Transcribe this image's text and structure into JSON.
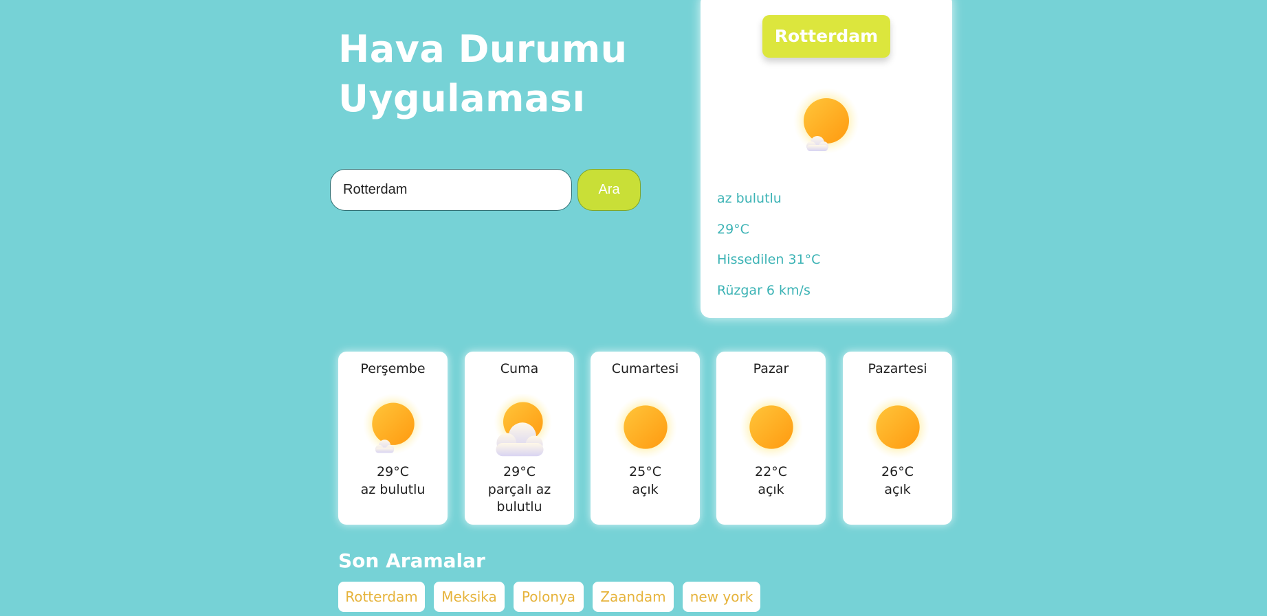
{
  "header": {
    "title_line1": "Hava Durumu",
    "title_line2": "Uygulaması"
  },
  "search": {
    "value": "Rotterdam",
    "button_label": "Ara"
  },
  "current": {
    "city": "Rotterdam",
    "icon": "sun-with-small-cloud-icon",
    "description": "az bulutlu",
    "temperature": "29°C",
    "feels_like": "Hissedilen 31°C",
    "wind": "Rüzgar 6 km/s"
  },
  "forecast": [
    {
      "day": "Perşembe",
      "temp": "29°C",
      "desc": "az bulutlu",
      "icon": "sun-with-small-cloud-icon"
    },
    {
      "day": "Cuma",
      "temp": "29°C",
      "desc": "parçalı az bulutlu",
      "icon": "sun-behind-cloud-icon"
    },
    {
      "day": "Cumartesi",
      "temp": "25°C",
      "desc": "açık",
      "icon": "sun-icon"
    },
    {
      "day": "Pazar",
      "temp": "22°C",
      "desc": "açık",
      "icon": "sun-icon"
    },
    {
      "day": "Pazartesi",
      "temp": "26°C",
      "desc": "açık",
      "icon": "sun-icon"
    }
  ],
  "recent": {
    "title": "Son Aramalar",
    "items": [
      "Rotterdam",
      "Meksika",
      "Polonya",
      "Zaandam",
      "new york"
    ]
  },
  "colors": {
    "background": "#76d2d6",
    "accent": "#dce63d",
    "button": "#c9df37",
    "current_text": "#3cb3b5",
    "chip_text": "#e6b33b"
  }
}
